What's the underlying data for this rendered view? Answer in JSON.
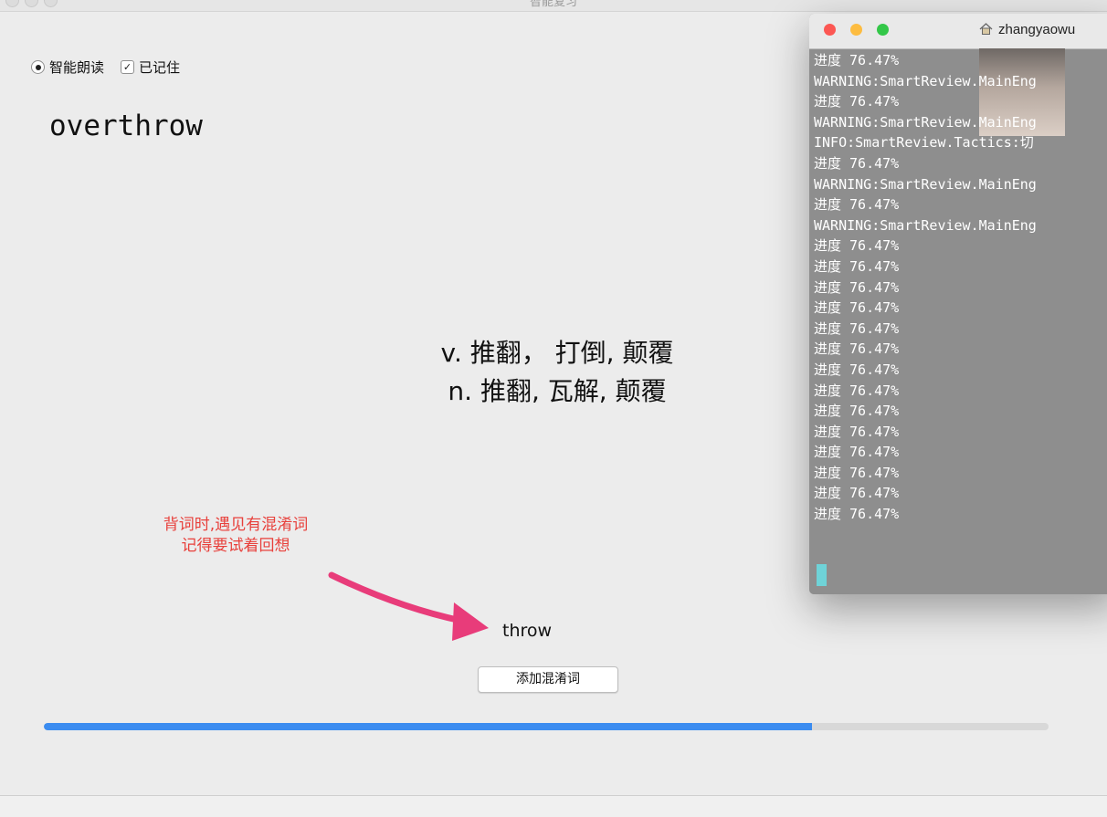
{
  "window": {
    "title": "智能复习"
  },
  "options": {
    "smart_read": "智能朗读",
    "remembered": "已记住"
  },
  "word": "overthrow",
  "definitions": {
    "verb": "v. 推翻， 打倒, 颠覆",
    "noun": "n. 推翻, 瓦解, 颠覆"
  },
  "annotation": {
    "line1": "背词时,遇见有混淆词",
    "line2": "记得要试着回想"
  },
  "confused_word": "throw",
  "add_button": "添加混淆词",
  "progress": {
    "fraction": 0.7647,
    "fill_color": "#3b8cf0"
  },
  "terminal": {
    "title": "zhangyaowu",
    "lines": [
      "进度 76.47%",
      "WARNING:SmartReview.MainEng",
      "进度 76.47%",
      "WARNING:SmartReview.MainEng",
      "INFO:SmartReview.Tactics:切",
      "进度 76.47%",
      "WARNING:SmartReview.MainEng",
      "进度 76.47%",
      "WARNING:SmartReview.MainEng",
      "进度 76.47%",
      "进度 76.47%",
      "进度 76.47%",
      "进度 76.47%",
      "进度 76.47%",
      "进度 76.47%",
      "进度 76.47%",
      "进度 76.47%",
      "进度 76.47%",
      "进度 76.47%",
      "进度 76.47%",
      "进度 76.47%",
      "进度 76.47%",
      "进度 76.47%"
    ]
  },
  "colors": {
    "annotation": "#e8403b",
    "arrow": "#e83c7a",
    "close": "#fc5753",
    "minimize": "#fdbc40",
    "zoom": "#33c748"
  }
}
